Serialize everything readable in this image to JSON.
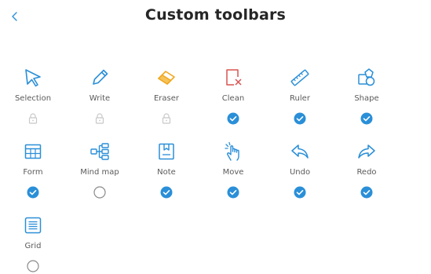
{
  "header": {
    "title": "Custom toolbars",
    "back_icon": "chevron-left-icon"
  },
  "colors": {
    "accent": "#2a8fd8",
    "clean_red": "#d9534f",
    "eraser_yellow": "#f0a81e",
    "locked_gray": "#c8c8c8",
    "label_gray": "#5a5a5a"
  },
  "tools": [
    {
      "label": "Selection",
      "icon": "selection-arrow-icon",
      "state": "locked"
    },
    {
      "label": "Write",
      "icon": "pen-icon",
      "state": "locked"
    },
    {
      "label": "Eraser",
      "icon": "eraser-icon",
      "state": "locked"
    },
    {
      "label": "Clean",
      "icon": "clean-page-icon",
      "state": "checked"
    },
    {
      "label": "Ruler",
      "icon": "ruler-icon",
      "state": "checked"
    },
    {
      "label": "Shape",
      "icon": "shapes-icon",
      "state": "checked"
    },
    {
      "label": "Form",
      "icon": "table-icon",
      "state": "checked"
    },
    {
      "label": "Mind map",
      "icon": "mind-map-icon",
      "state": "unchecked"
    },
    {
      "label": "Note",
      "icon": "note-icon",
      "state": "checked"
    },
    {
      "label": "Move",
      "icon": "hand-move-icon",
      "state": "checked"
    },
    {
      "label": "Undo",
      "icon": "undo-icon",
      "state": "checked"
    },
    {
      "label": "Redo",
      "icon": "redo-icon",
      "state": "checked"
    },
    {
      "label": "Grid",
      "icon": "grid-lines-icon",
      "state": "unchecked"
    }
  ]
}
